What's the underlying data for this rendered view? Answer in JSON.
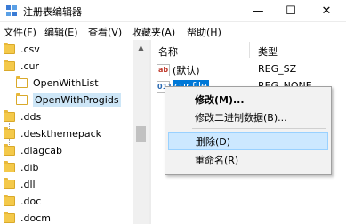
{
  "window": {
    "title": "注册表编辑器",
    "minimize_glyph": "—",
    "maximize_glyph": "☐",
    "close_glyph": "✕"
  },
  "menu": [
    "文件(F)",
    "编辑(E)",
    "查看(V)",
    "收藏夹(A)",
    "帮助(H)"
  ],
  "tree": {
    "items": [
      {
        "label": ".csv"
      },
      {
        "label": ".cur"
      },
      {
        "label": "OpenWithList"
      },
      {
        "label": "OpenWithProgids"
      },
      {
        "label": ".dds"
      },
      {
        "label": ".deskthemepack"
      },
      {
        "label": ".diagcab"
      },
      {
        "label": ".dib"
      },
      {
        "label": ".dll"
      },
      {
        "label": ".doc"
      },
      {
        "label": ".docm"
      }
    ],
    "scroll_up_glyph": "▲"
  },
  "list": {
    "col_name": "名称",
    "col_type": "类型",
    "rows": [
      {
        "icon_text": "ab",
        "name": "(默认)",
        "type": "REG_SZ"
      },
      {
        "icon_text": "011",
        "name": "cur.file",
        "type": "REG_NONE"
      }
    ]
  },
  "context_menu": {
    "items": [
      "修改(M)...",
      "修改二进制数据(B)...",
      "删除(D)",
      "重命名(R)"
    ],
    "highlighted": "删除(D)"
  },
  "colors": {
    "selection": "#0078d7",
    "hover": "#cce8ff",
    "folder": "#f4c94a"
  }
}
